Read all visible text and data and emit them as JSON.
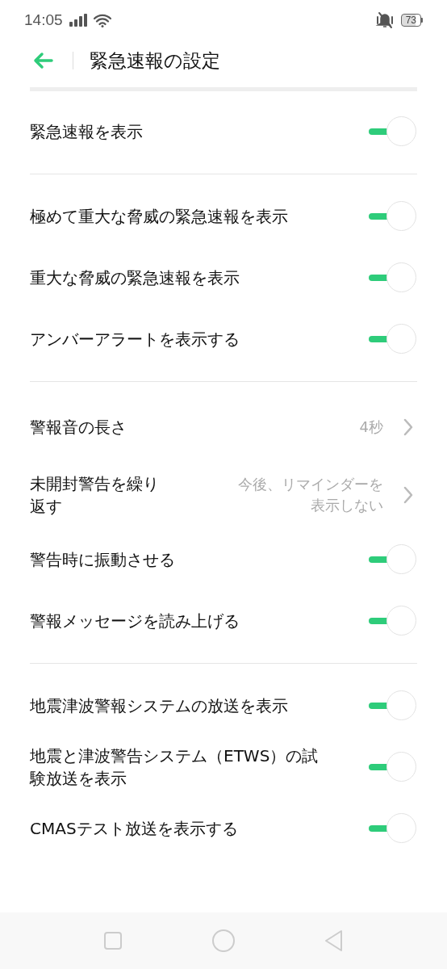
{
  "status_bar": {
    "time": "14:05",
    "battery": "73"
  },
  "header": {
    "title": "緊急速報の設定"
  },
  "sections": [
    {
      "rows": [
        {
          "kind": "toggle",
          "label": "緊急速報を表示",
          "on": true
        }
      ]
    },
    {
      "rows": [
        {
          "kind": "toggle",
          "label": "極めて重大な脅威の緊急速報を表示",
          "on": true
        },
        {
          "kind": "toggle",
          "label": "重大な脅威の緊急速報を表示",
          "on": true
        },
        {
          "kind": "toggle",
          "label": "アンバーアラートを表示する",
          "on": true
        }
      ]
    },
    {
      "rows": [
        {
          "kind": "value",
          "label": "警報音の長さ",
          "value": "4秒"
        },
        {
          "kind": "value",
          "label": "未開封警告を繰り返す",
          "value": "今後、リマインダーを表示しない"
        },
        {
          "kind": "toggle",
          "label": "警告時に振動させる",
          "on": true
        },
        {
          "kind": "toggle",
          "label": "警報メッセージを読み上げる",
          "on": true
        }
      ]
    },
    {
      "rows": [
        {
          "kind": "toggle",
          "label": "地震津波警報システムの放送を表示",
          "on": true
        },
        {
          "kind": "toggle",
          "label": "地震と津波警告システム（ETWS）の試験放送を表示",
          "on": true
        },
        {
          "kind": "toggle",
          "label": "CMASテスト放送を表示する",
          "on": true
        }
      ]
    }
  ]
}
